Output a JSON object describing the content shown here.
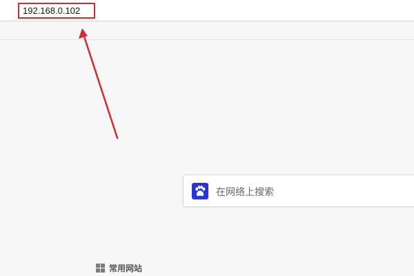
{
  "address_bar": {
    "url": "192.168.0.102"
  },
  "annotation": {
    "highlight_color": "#d7282d"
  },
  "search": {
    "placeholder": "在网络上搜索",
    "engine_icon": "baidu-paw-icon",
    "engine_color": "#2932e1"
  },
  "common_sites": {
    "label": "常用网站",
    "icon": "grid-icon"
  }
}
